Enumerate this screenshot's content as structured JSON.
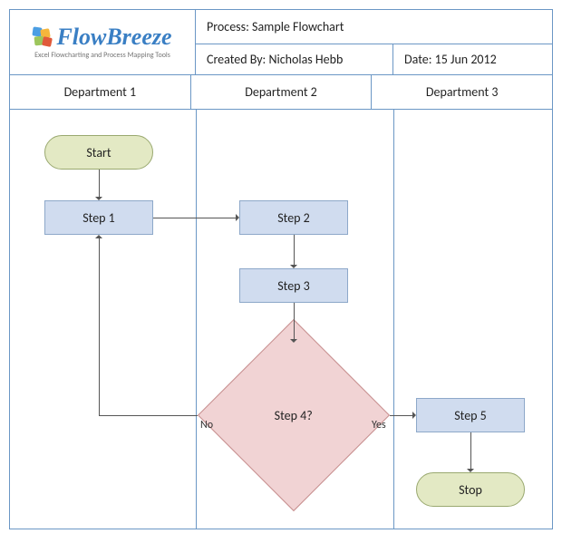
{
  "brand": "FlowBreeze",
  "tagline": "Excel Flowcharting and Process Mapping Tools",
  "header": {
    "process_label": "Process:",
    "process_value": "Sample Flowchart",
    "created_label": "Created By:",
    "created_value": "Nicholas Hebb",
    "date_label": "Date:",
    "date_value": "15 Jun 2012"
  },
  "lanes": {
    "d1": "Department 1",
    "d2": "Department 2",
    "d3": "Department 3"
  },
  "nodes": {
    "start": "Start",
    "step1": "Step 1",
    "step2": "Step 2",
    "step3": "Step 3",
    "step4": "Step 4?",
    "step5": "Step 5",
    "stop": "Stop"
  },
  "edges": {
    "no": "No",
    "yes": "Yes"
  }
}
